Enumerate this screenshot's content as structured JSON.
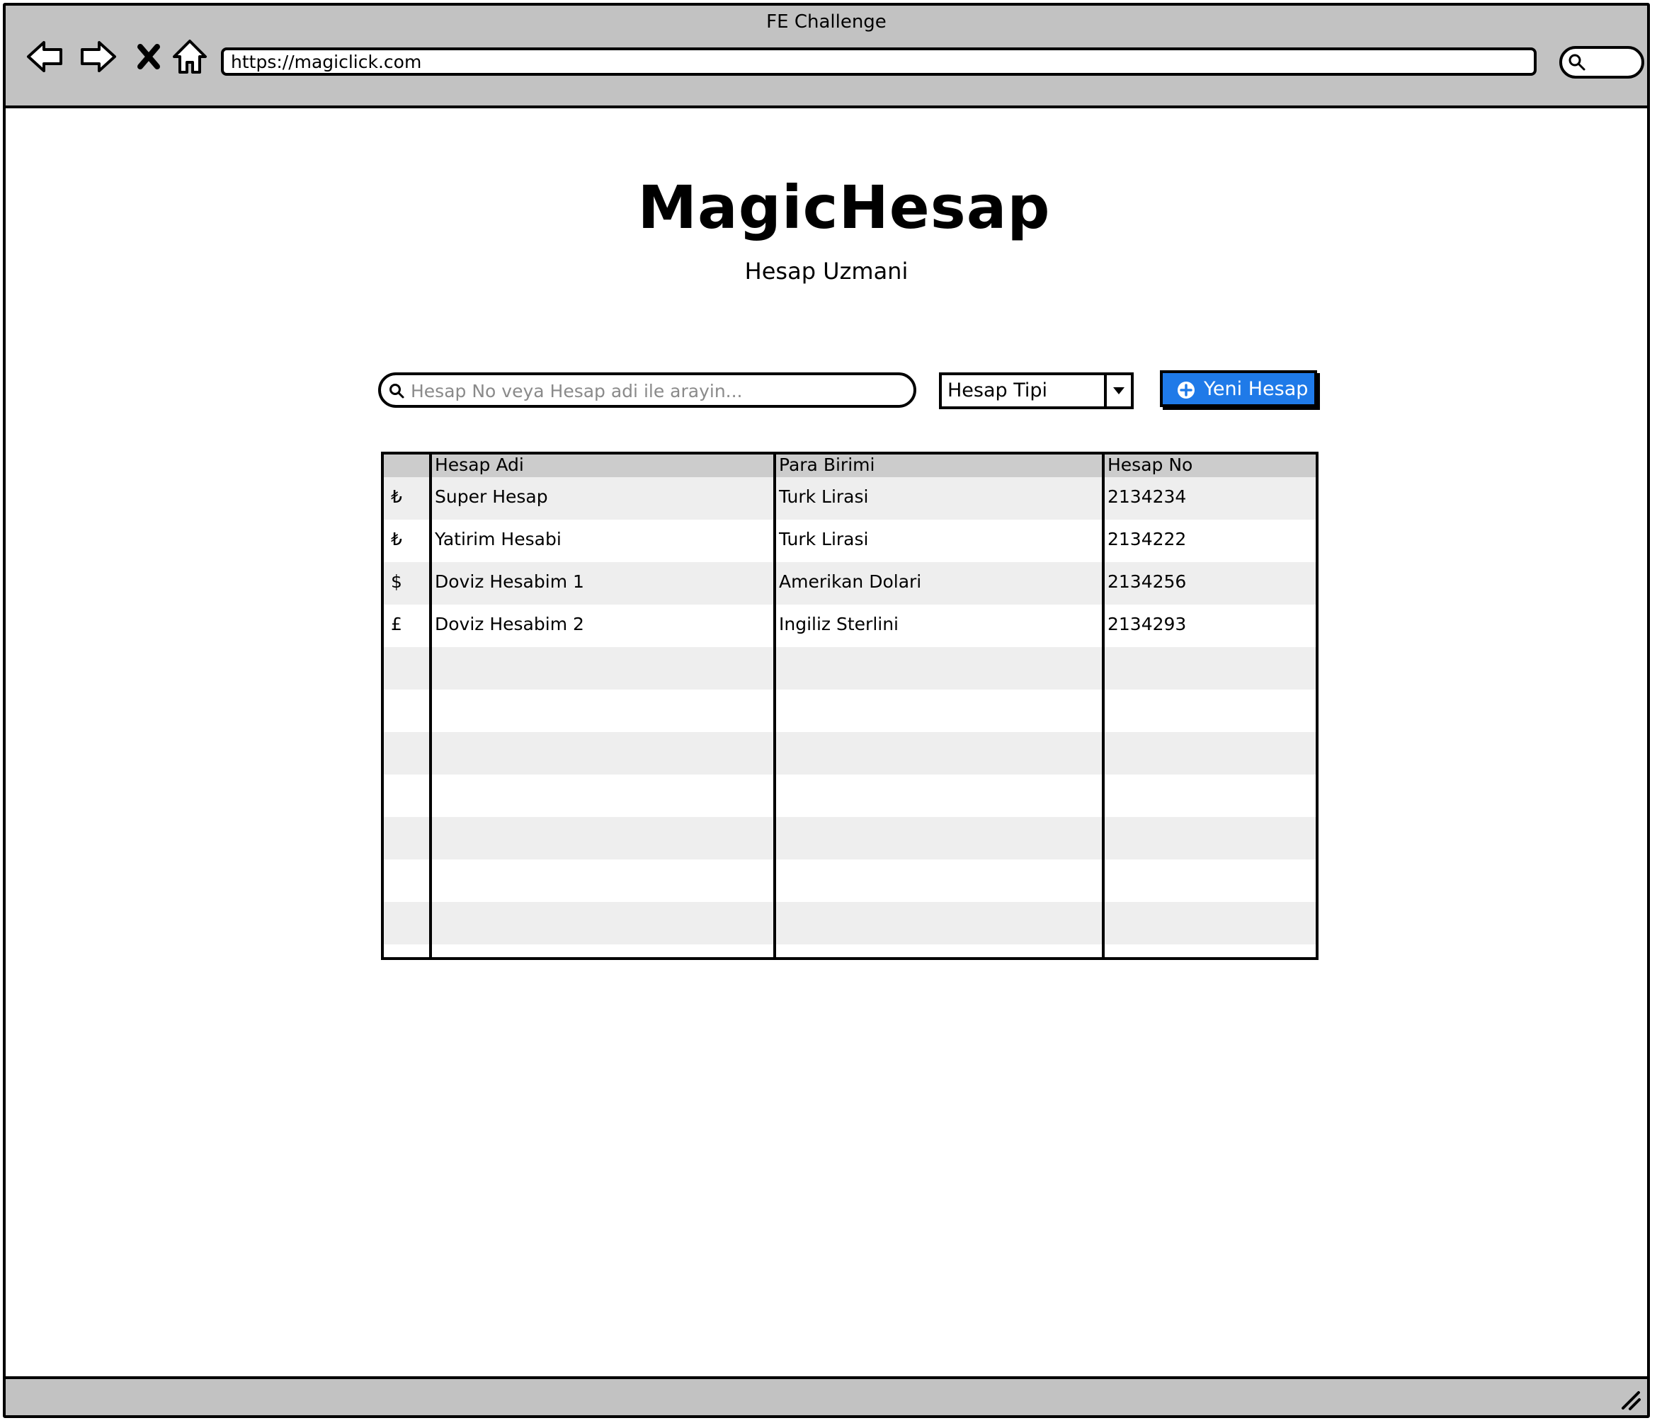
{
  "browser": {
    "window_title": "FE Challenge",
    "url": "https://magiclick.com"
  },
  "app": {
    "title": "MagicHesap",
    "subtitle": "Hesap Uzmani"
  },
  "toolbar": {
    "search_placeholder": "Hesap No veya Hesap adi ile arayin...",
    "account_type_selected": "Hesap Tipi",
    "new_account_label": "Yeni Hesap"
  },
  "table": {
    "columns": [
      "",
      "Hesap Adi",
      "Para Birimi",
      "Hesap No"
    ],
    "rows": [
      {
        "symbol": "₺",
        "name": "Super Hesap",
        "currency": "Turk Lirasi",
        "number": "2134234"
      },
      {
        "symbol": "₺",
        "name": "Yatirim Hesabi",
        "currency": "Turk Lirasi",
        "number": "2134222"
      },
      {
        "symbol": "$",
        "name": "Doviz Hesabim 1",
        "currency": "Amerikan Dolari",
        "number": "2134256"
      },
      {
        "symbol": "£",
        "name": "Doviz Hesabim 2",
        "currency": "Ingiliz Sterlini",
        "number": "2134293"
      }
    ]
  },
  "colors": {
    "chrome": "#c2c2c2",
    "button_blue": "#1f7ae8",
    "header_row": "#cccccc",
    "alt_row": "#eeeeee"
  }
}
